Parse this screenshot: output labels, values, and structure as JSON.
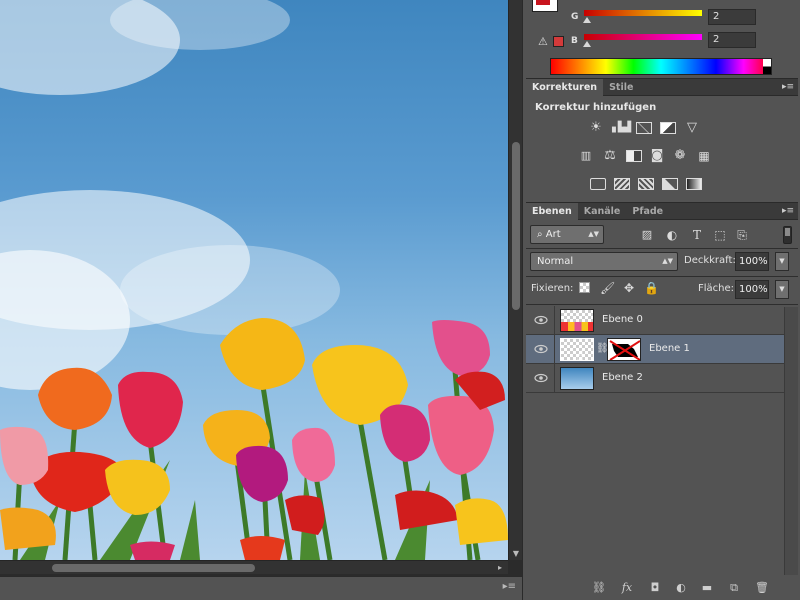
{
  "color_panel": {
    "channels": [
      {
        "label": "G",
        "value": "2"
      },
      {
        "label": "B",
        "value": "2"
      }
    ],
    "fg_color": "#c8141e"
  },
  "adjustments_panel": {
    "tabs": [
      "Korrekturen",
      "Stile"
    ],
    "title": "Korrektur hinzufügen",
    "icons_row1": [
      "brightness-contrast-icon",
      "levels-icon",
      "curves-icon",
      "exposure-icon",
      "vibrance-icon"
    ],
    "icons_row2": [
      "hue-saturation-icon",
      "color-balance-icon",
      "black-white-icon",
      "photo-filter-icon",
      "channel-mixer-icon",
      "color-lookup-icon"
    ],
    "icons_row3": [
      "invert-icon",
      "posterize-icon",
      "threshold-icon",
      "selective-color-icon",
      "gradient-map-icon"
    ]
  },
  "layers_panel": {
    "tabs": [
      "Ebenen",
      "Kanäle",
      "Pfade"
    ],
    "filter": {
      "label": "Art"
    },
    "blend_mode": "Normal",
    "opacity": {
      "label": "Deckkraft:",
      "value": "100%"
    },
    "lock": {
      "label": "Fixieren:"
    },
    "fill": {
      "label": "Fläche:",
      "value": "100%"
    },
    "layers": [
      {
        "name": "Ebene 0",
        "selected": false
      },
      {
        "name": "Ebene 1",
        "selected": true
      },
      {
        "name": "Ebene 2",
        "selected": false
      }
    ]
  }
}
